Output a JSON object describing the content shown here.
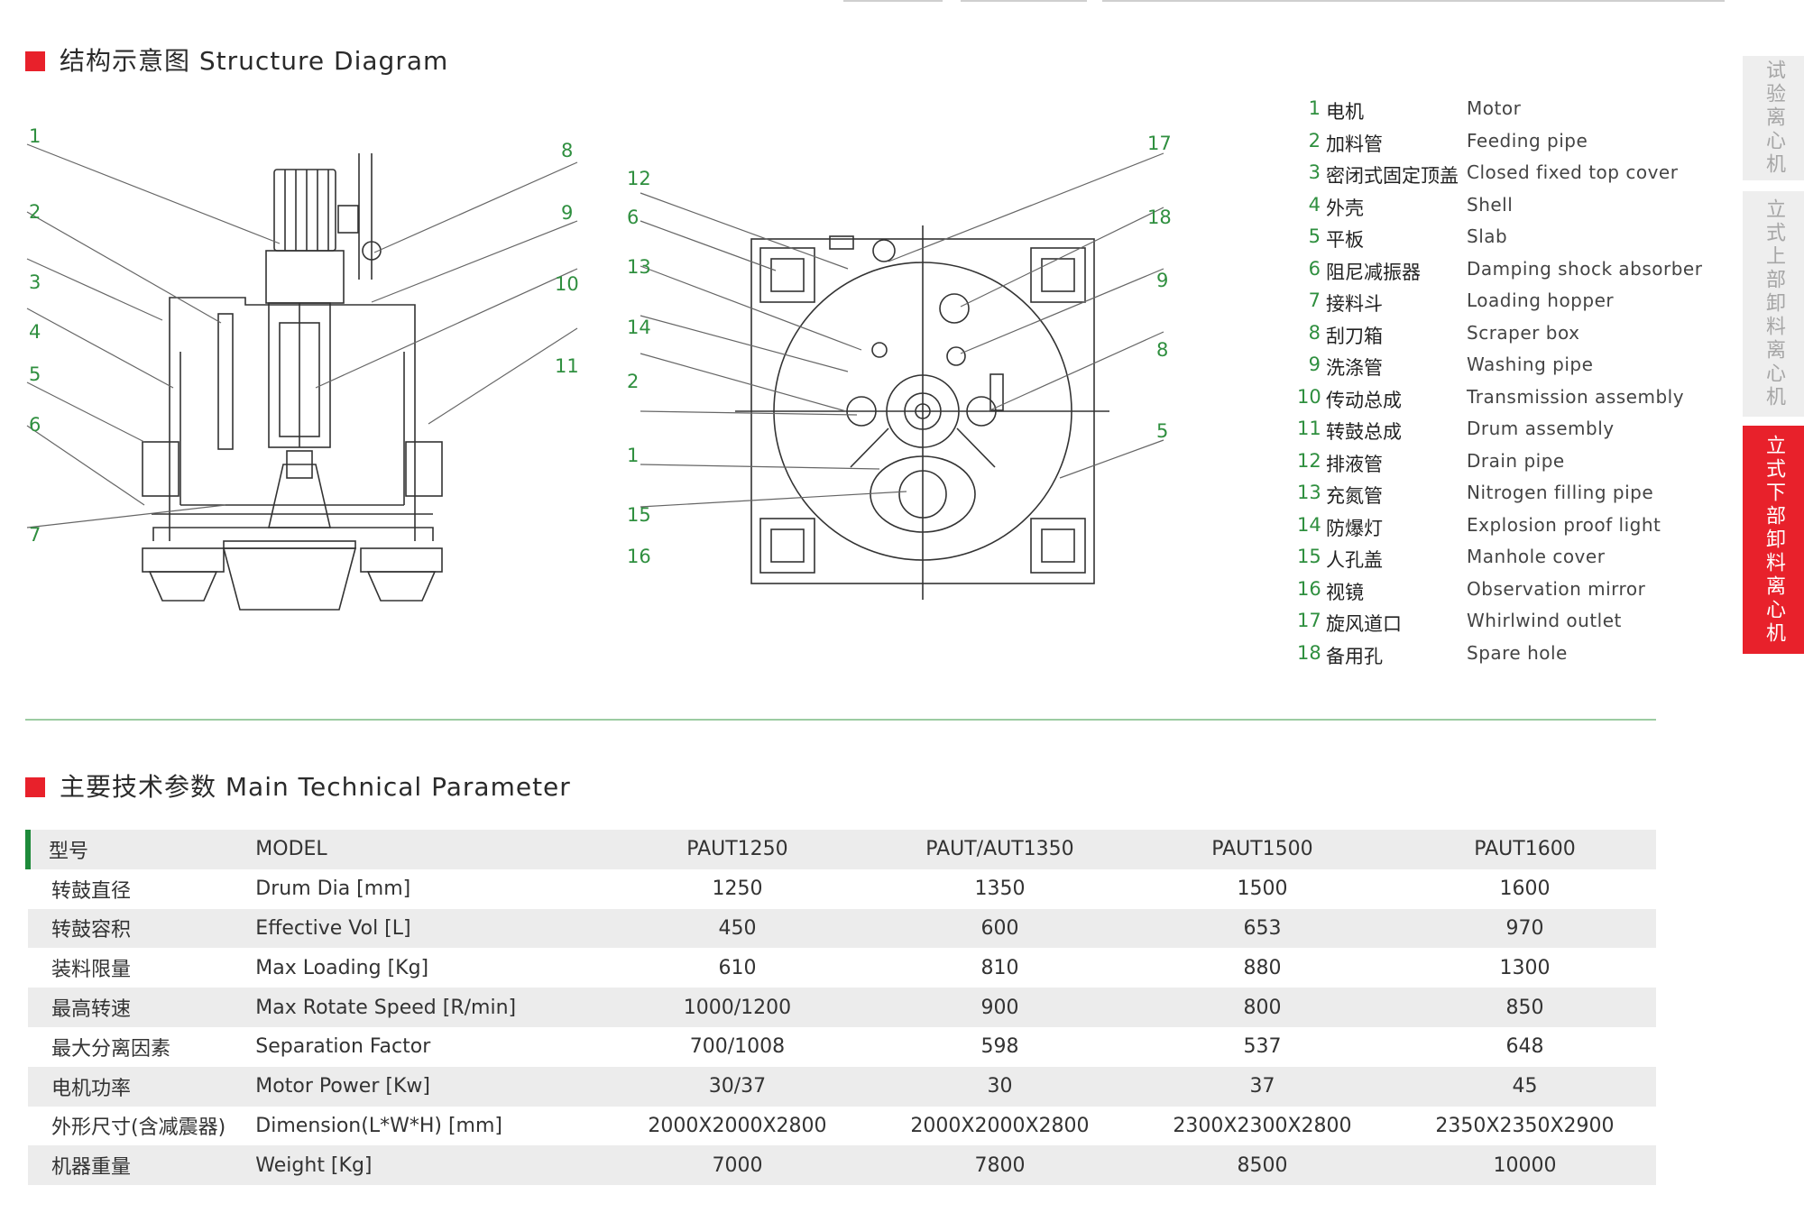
{
  "structure": {
    "title": "结构示意图 Structure Diagram",
    "left_callouts": [
      "1",
      "2",
      "3",
      "4",
      "5",
      "6",
      "7",
      "8",
      "9",
      "10",
      "11"
    ],
    "right_callouts": [
      "12",
      "6",
      "13",
      "14",
      "2",
      "1",
      "15",
      "16",
      "17",
      "18",
      "9",
      "8",
      "5"
    ]
  },
  "legend": [
    {
      "num": "1",
      "cn": "电机",
      "en": "Motor"
    },
    {
      "num": "2",
      "cn": "加料管",
      "en": "Feeding pipe"
    },
    {
      "num": "3",
      "cn": "密闭式固定顶盖",
      "en": "Closed fixed top cover"
    },
    {
      "num": "4",
      "cn": "外壳",
      "en": "Shell"
    },
    {
      "num": "5",
      "cn": "平板",
      "en": "Slab"
    },
    {
      "num": "6",
      "cn": "阻尼减振器",
      "en": "Damping shock absorber"
    },
    {
      "num": "7",
      "cn": "接料斗",
      "en": "Loading hopper"
    },
    {
      "num": "8",
      "cn": "刮刀箱",
      "en": "Scraper box"
    },
    {
      "num": "9",
      "cn": "洗涤管",
      "en": "Washing pipe"
    },
    {
      "num": "10",
      "cn": "传动总成",
      "en": "Transmission assembly"
    },
    {
      "num": "11",
      "cn": "转鼓总成",
      "en": "Drum assembly"
    },
    {
      "num": "12",
      "cn": "排液管",
      "en": "Drain pipe"
    },
    {
      "num": "13",
      "cn": "充氮管",
      "en": "Nitrogen filling pipe"
    },
    {
      "num": "14",
      "cn": "防爆灯",
      "en": "Explosion proof light"
    },
    {
      "num": "15",
      "cn": "人孔盖",
      "en": "Manhole cover"
    },
    {
      "num": "16",
      "cn": "视镜",
      "en": "Observation mirror"
    },
    {
      "num": "17",
      "cn": "旋风道口",
      "en": "Whirlwind outlet"
    },
    {
      "num": "18",
      "cn": "备用孔",
      "en": "Spare hole"
    }
  ],
  "params": {
    "title": "主要技术参数 Main Technical Parameter",
    "header": {
      "cn": "型号",
      "en": "MODEL",
      "values": [
        "PAUT1250",
        "PAUT/AUT1350",
        "PAUT1500",
        "PAUT1600"
      ]
    },
    "rows": [
      {
        "cn": "转鼓直径",
        "en": "Drum Dia [mm]",
        "values": [
          "1250",
          "1350",
          "1500",
          "1600"
        ]
      },
      {
        "cn": "转鼓容积",
        "en": "Effective Vol [L]",
        "values": [
          "450",
          "600",
          "653",
          "970"
        ]
      },
      {
        "cn": "装料限量",
        "en": "Max Loading [Kg]",
        "values": [
          "610",
          "810",
          "880",
          "1300"
        ]
      },
      {
        "cn": "最高转速",
        "en": "Max Rotate Speed [R/min]",
        "values": [
          "1000/1200",
          "900",
          "800",
          "850"
        ]
      },
      {
        "cn": "最大分离因素",
        "en": "Separation Factor",
        "values": [
          "700/1008",
          "598",
          "537",
          "648"
        ]
      },
      {
        "cn": "电机功率",
        "en": "Motor Power [Kw]",
        "values": [
          "30/37",
          "30",
          "37",
          "45"
        ]
      },
      {
        "cn": "外形尺寸(含减震器)",
        "en": "Dimension(L*W*H) [mm]",
        "values": [
          "2000X2000X2800",
          "2000X2000X2800",
          "2300X2300X2800",
          "2350X2350X2900"
        ]
      },
      {
        "cn": "机器重量",
        "en": "Weight [Kg]",
        "values": [
          "7000",
          "7800",
          "8500",
          "10000"
        ]
      }
    ]
  },
  "side_tabs": [
    {
      "label": "试验离心机",
      "active": false
    },
    {
      "label": "立式上部卸料离心机",
      "active": false
    },
    {
      "label": "立式下部卸料离心机",
      "active": true
    }
  ],
  "colors": {
    "accent_red": "#e8212b",
    "accent_green": "#2f8f3f"
  }
}
